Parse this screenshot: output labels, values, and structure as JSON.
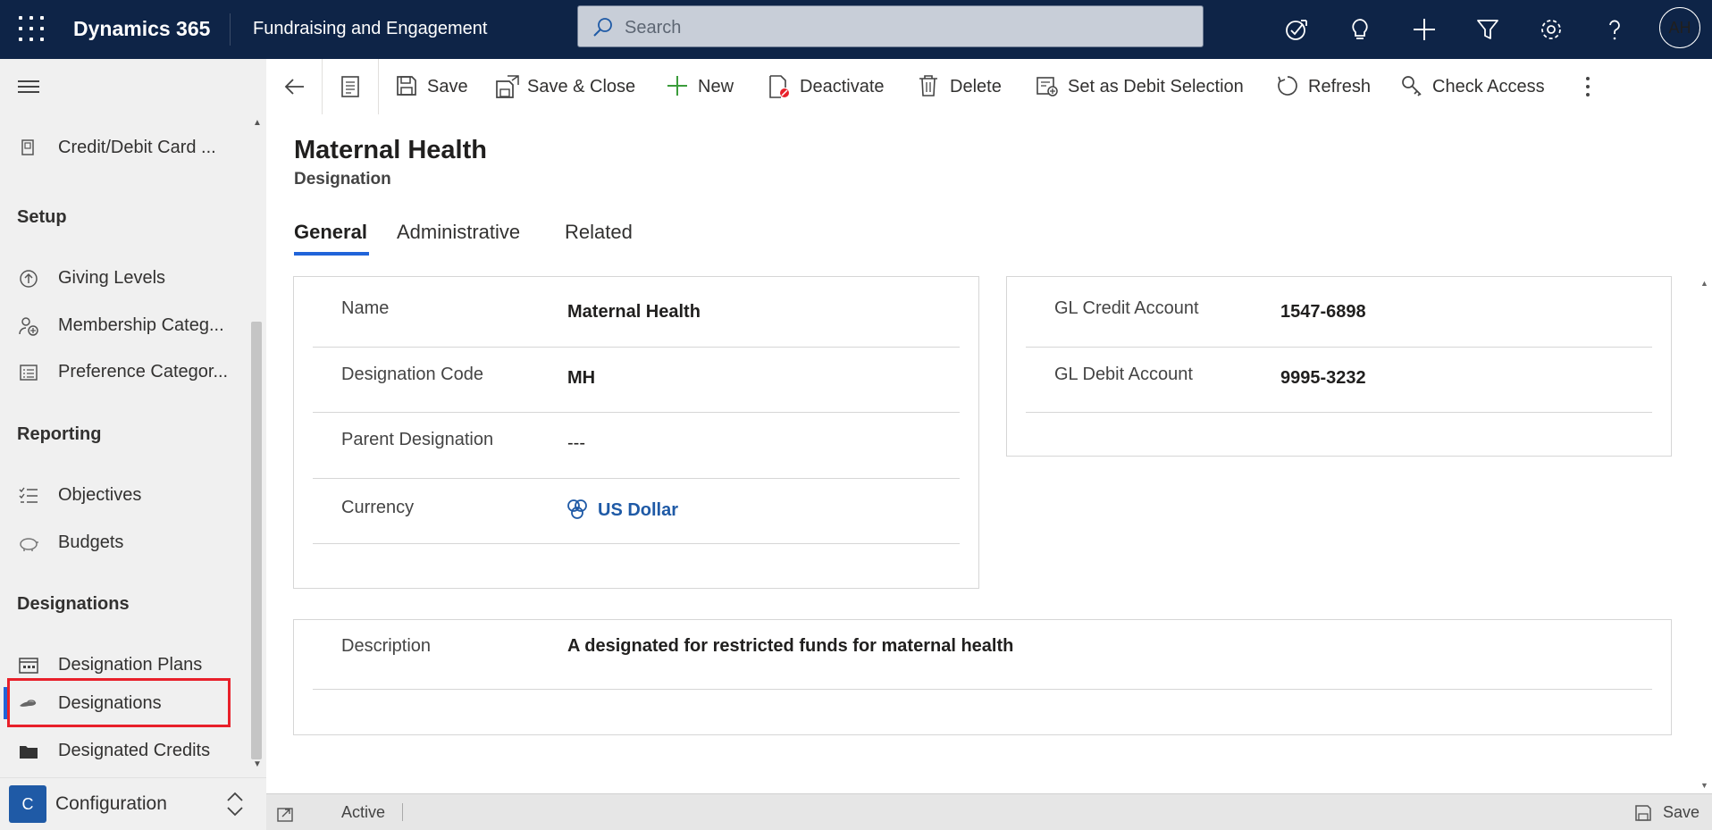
{
  "header": {
    "app_name": "Dynamics 365",
    "module_name": "Fundraising and Engagement",
    "search_placeholder": "Search",
    "icons": [
      "assistant-icon",
      "lightbulb-icon",
      "plus-icon",
      "filter-icon",
      "gear-icon",
      "help-icon"
    ],
    "avatar_initials": "AH"
  },
  "sidebar": {
    "top_item": "Credit/Debit Card ...",
    "groups": [
      {
        "title": "Setup",
        "items": [
          "Giving Levels",
          "Membership Categ...",
          "Preference Categor..."
        ]
      },
      {
        "title": "Reporting",
        "items": [
          "Objectives",
          "Budgets"
        ]
      },
      {
        "title": "Designations",
        "items": [
          "Designation Plans",
          "Designations",
          "Designated Credits"
        ]
      }
    ],
    "selected_item": "Designations",
    "area": {
      "badge": "C",
      "label": "Configuration"
    }
  },
  "command_bar": {
    "save": "Save",
    "save_close": "Save & Close",
    "new": "New",
    "deactivate": "Deactivate",
    "delete": "Delete",
    "set_debit": "Set as Debit Selection",
    "refresh": "Refresh",
    "check_access": "Check Access"
  },
  "record": {
    "title": "Maternal Health",
    "entity": "Designation",
    "tabs": [
      "General",
      "Administrative",
      "Related"
    ],
    "active_tab": "General",
    "left_fields": [
      {
        "label": "Name",
        "value": "Maternal Health"
      },
      {
        "label": "Designation Code",
        "value": "MH"
      },
      {
        "label": "Parent Designation",
        "value": "---"
      },
      {
        "label": "Currency",
        "value": "US Dollar"
      }
    ],
    "right_fields": [
      {
        "label": "GL Credit Account",
        "value": "1547-6898"
      },
      {
        "label": "GL Debit Account",
        "value": "9995-3232"
      }
    ],
    "description": {
      "label": "Description",
      "value": "A designated for restricted funds for maternal health"
    }
  },
  "status_bar": {
    "status": "Active",
    "save": "Save"
  },
  "colors": {
    "header_bg": "#0e2447",
    "accent": "#2064d9",
    "link": "#1f5aa6",
    "highlight": "#e8202a"
  }
}
